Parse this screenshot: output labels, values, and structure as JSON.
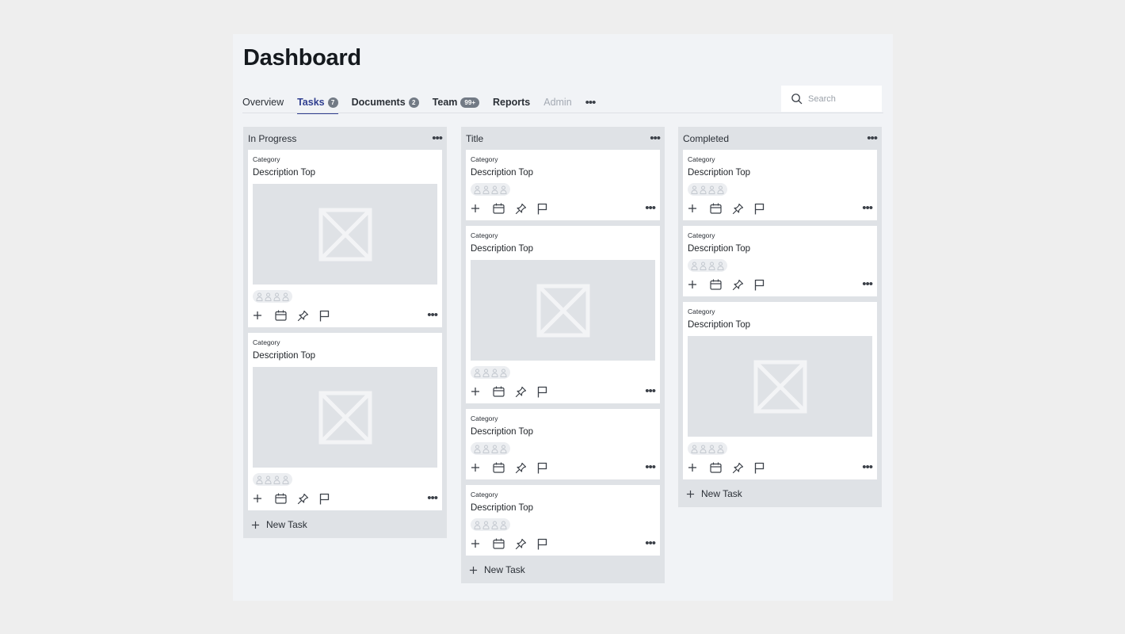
{
  "page": {
    "title": "Dashboard"
  },
  "tabs": [
    {
      "label": "Overview",
      "badge": ""
    },
    {
      "label": "Tasks",
      "badge": "7",
      "active": true
    },
    {
      "label": "Documents",
      "badge": "2"
    },
    {
      "label": "Team",
      "badge": "99+"
    },
    {
      "label": "Reports",
      "badge": ""
    },
    {
      "label": "Admin",
      "badge": "",
      "disabled": true
    }
  ],
  "tabs_more": "•••",
  "search": {
    "placeholder": "Search",
    "value": ""
  },
  "card_more": "•••",
  "new_task_label": "New Task",
  "columns": [
    {
      "title": "In Progress",
      "cards": [
        {
          "category": "Category",
          "description": "Description Top",
          "has_image": true
        },
        {
          "category": "Category",
          "description": "Description Top",
          "has_image": true
        }
      ]
    },
    {
      "title": "Title",
      "cards": [
        {
          "category": "Category",
          "description": "Description Top",
          "has_image": false
        },
        {
          "category": "Category",
          "description": "Description Top",
          "has_image": true
        },
        {
          "category": "Category",
          "description": "Description Top",
          "has_image": false
        },
        {
          "category": "Category",
          "description": "Description Top",
          "has_image": false
        }
      ]
    },
    {
      "title": "Completed",
      "cards": [
        {
          "category": "Category",
          "description": "Description Top",
          "has_image": false
        },
        {
          "category": "Category",
          "description": "Description Top",
          "has_image": false
        },
        {
          "category": "Category",
          "description": "Description Top",
          "has_image": true
        }
      ]
    }
  ],
  "colors": {
    "accent": "#2f3e8f",
    "page_bg": "#f1f3f6",
    "column_bg": "#dfe2e6",
    "card_bg": "#ffffff",
    "badge_bg": "#727a85",
    "disabled_text": "#a4aab3"
  },
  "icons": {
    "search": "search-icon",
    "card_actions": [
      "plus-icon",
      "calendar-icon",
      "pin-icon",
      "flag-icon"
    ],
    "placeholder": "image-placeholder-icon",
    "avatar": "user-icon"
  }
}
